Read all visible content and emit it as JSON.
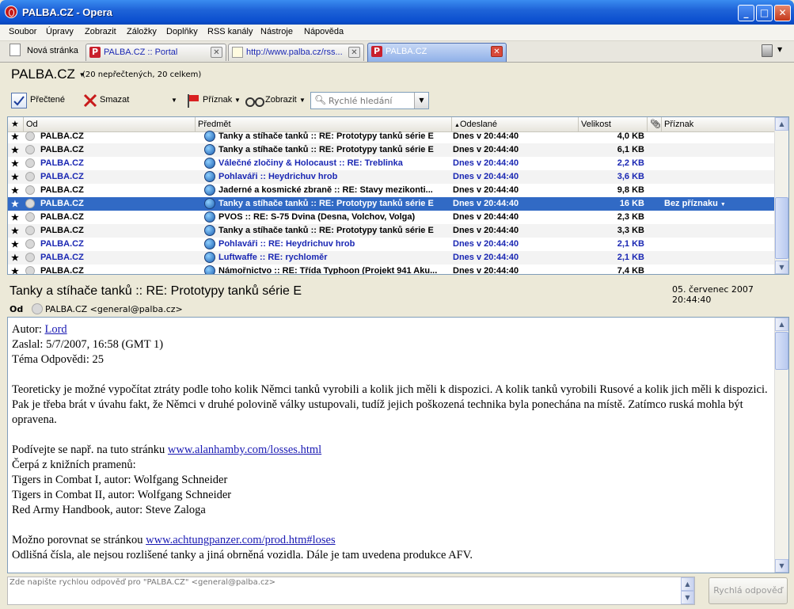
{
  "window": {
    "title": "PALBA.CZ - Opera"
  },
  "menu": [
    "Soubor",
    "Úpravy",
    "Zobrazit",
    "Záložky",
    "Doplňky",
    "RSS kanály",
    "Nástroje",
    "Nápověda"
  ],
  "tabs": {
    "new_tab": "Nová stránka",
    "items": [
      {
        "label": "PALBA.CZ :: Portal",
        "icon": "p-icon"
      },
      {
        "label": "http://www.palba.cz/rss...",
        "icon": "page-icon"
      },
      {
        "label": "PALBA.CZ",
        "icon": "p-icon",
        "active": true
      }
    ]
  },
  "account": {
    "name": "PALBA.CZ",
    "counts": "(20 nepřečtených, 20 celkem)"
  },
  "toolbar": {
    "read": "Přečtené",
    "delete": "Smazat",
    "flag": "Příznak",
    "view": "Zobrazit",
    "search_placeholder": "Rychlé hledání"
  },
  "list": {
    "columns": {
      "from": "Od",
      "subject": "Předmět",
      "sent": "Odeslané",
      "size": "Velikost",
      "flag": "Příznak"
    },
    "rows": [
      {
        "from": "PALBA.CZ",
        "subject": "Tanky a stíhače tanků :: RE: Prototypy tanků série E",
        "date": "Dnes v 20:44:40",
        "size": "4,0 KB",
        "unread": false
      },
      {
        "from": "PALBA.CZ",
        "subject": "Tanky a stíhače tanků :: RE: Prototypy tanků série E",
        "date": "Dnes v 20:44:40",
        "size": "6,1 KB",
        "unread": false
      },
      {
        "from": "PALBA.CZ",
        "subject": "Válečné zločiny & Holocaust :: RE: Treblinka",
        "date": "Dnes v 20:44:40",
        "size": "2,2 KB",
        "unread": true
      },
      {
        "from": "PALBA.CZ",
        "subject": "Pohlaváři :: Heydrichuv hrob",
        "date": "Dnes v 20:44:40",
        "size": "3,6 KB",
        "unread": true
      },
      {
        "from": "PALBA.CZ",
        "subject": "Jaderné a kosmické zbraně :: RE: Stavy mezikonti...",
        "date": "Dnes v 20:44:40",
        "size": "9,8 KB",
        "unread": false
      },
      {
        "from": "PALBA.CZ",
        "subject": "Tanky a stíhače tanků :: RE: Prototypy tanků série E",
        "date": "Dnes v 20:44:40",
        "size": "16 KB",
        "unread": false,
        "selected": true,
        "flag": "Bez příznaku"
      },
      {
        "from": "PALBA.CZ",
        "subject": "PVOS :: RE: S-75 Dvina (Desna, Volchov, Volga)",
        "date": "Dnes v 20:44:40",
        "size": "2,3 KB",
        "unread": false
      },
      {
        "from": "PALBA.CZ",
        "subject": "Tanky a stíhače tanků :: RE: Prototypy tanků série E",
        "date": "Dnes v 20:44:40",
        "size": "3,3 KB",
        "unread": false
      },
      {
        "from": "PALBA.CZ",
        "subject": "Pohlaváři :: RE: Heydrichuv hrob",
        "date": "Dnes v 20:44:40",
        "size": "2,1 KB",
        "unread": true
      },
      {
        "from": "PALBA.CZ",
        "subject": "Luftwaffe :: RE: rychloměr",
        "date": "Dnes v 20:44:40",
        "size": "2,1 KB",
        "unread": true
      },
      {
        "from": "PALBA.CZ",
        "subject": "Námořnictvo :: RE: Třída Typhoon (Projekt 941 Aku...",
        "date": "Dnes v 20:44:40",
        "size": "7,4 KB",
        "unread": false
      }
    ]
  },
  "message": {
    "subject": "Tanky a stíhače tanků :: RE: Prototypy tanků série E",
    "date": "05. červenec 2007 20:44:40",
    "from_label": "Od",
    "from": "PALBA.CZ <general@palba.cz>",
    "author_label": "Autor: ",
    "author": "Lord",
    "sent_line": "Zaslal: 5/7/2007, 16:58 (GMT 1)",
    "replies_line": "Téma Odpovědi: 25",
    "para1": "Teoreticky je možné vypočítat ztráty podle toho kolik Němci tanků vyrobili a kolik jich měli k dispozici. A kolik tanků vyrobili Rusové a kolik jich měli k dispozici. Pak je třeba brát v úvahu fakt, že Němci v druhé polovině války ustupovali, tudíž jejich poškozená technika byla ponechána na místě. Zatímco ruská mohla být opravena.",
    "see_text": "Podívejte se např. na tuto stránku ",
    "link1": "www.alanhamby.com/losses.html",
    "books_intro": "Čerpá z knižních pramenů:",
    "book1": "Tigers in Combat I, autor: Wolfgang Schneider",
    "book2": "Tigers in Combat II, autor: Wolfgang Schneider",
    "book3": "Red Army Handbook, autor: Steve Zaloga",
    "compare_text": "Možno porovnat se stránkou ",
    "link2": "www.achtungpanzer.com/prod.htm#loses",
    "last_line": "Odlišná čísla, ale nejsou rozlišené tanky a jiná obrněná vozidla. Dále je tam uvedena produkce AFV."
  },
  "reply": {
    "placeholder": "Zde napište rychlou odpověď pro \"PALBA.CZ\" <general@palba.cz>",
    "button": "Rychlá odpověď"
  }
}
